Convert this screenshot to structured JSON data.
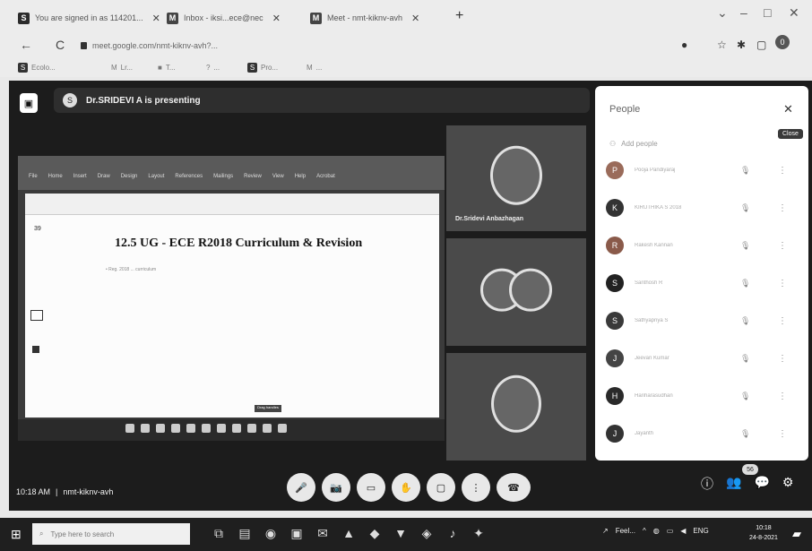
{
  "browser": {
    "tabs": [
      {
        "icon": "S",
        "label": "You are signed in as 114201..."
      },
      {
        "icon": "M",
        "label": "Inbox - iksi...ece@nec"
      },
      {
        "icon": "M",
        "label": "Meet - nmt-kiknv-avh"
      }
    ],
    "new_tab": "+",
    "window_controls": [
      "⌄",
      "–",
      "□",
      "✕"
    ],
    "back": "←",
    "reload": "C",
    "url": "meet.google.com/nmt-kiknv-avh?...",
    "profile_initial": "0"
  },
  "bookmarks": [
    {
      "icon": "S",
      "label": "Ecolo..."
    },
    {
      "icon": "M",
      "label": "Lr..."
    },
    {
      "icon": "■",
      "label": "T..."
    },
    {
      "icon": "?",
      "label": "..."
    },
    {
      "icon": "S",
      "label": "Pro..."
    },
    {
      "icon": "M",
      "label": "..."
    }
  ],
  "meet": {
    "presenting_text": "Dr.SRIDEVI A is presenting",
    "presenter_initial": "S",
    "shared_doc": {
      "ribbon_menu": [
        "File",
        "Home",
        "Insert",
        "Draw",
        "Design",
        "Layout",
        "References",
        "Mailings",
        "Review",
        "View",
        "Help",
        "Acrobat"
      ],
      "page_num": "39",
      "title": "12.5 UG - ECE R2018 Curriculum & Revision",
      "subtitle": "• Reg. 2018 ... curriculum",
      "footer_tag": "Drag handles"
    },
    "tiles": [
      {
        "name": "Dr.Sridevi Anbazhagan"
      },
      {
        "name": ""
      },
      {
        "name": ""
      }
    ],
    "meeting_time": "10:18 AM",
    "meeting_code": "nmt-kiknv-avh",
    "participant_count": "56"
  },
  "people_panel": {
    "title": "People",
    "close_tooltip": "Close",
    "add_people": "Add people",
    "participants": [
      {
        "initial": "P",
        "name": "Pooja Pandiyaraj"
      },
      {
        "initial": "K",
        "name": "KIRUTHIKA S 2018"
      },
      {
        "initial": "R",
        "name": "Rakesh Kannan"
      },
      {
        "initial": "S",
        "name": "Santhosh R"
      },
      {
        "initial": "S",
        "name": "Sathyapriya S"
      },
      {
        "initial": "J",
        "name": "Jeevan Kumar"
      },
      {
        "initial": "H",
        "name": "Hariharasudhan"
      },
      {
        "initial": "J",
        "name": "Jayanth"
      }
    ]
  },
  "controls": [
    "🎤",
    "📷",
    "▭",
    "✋",
    "▢",
    "⋮",
    "☎"
  ],
  "right_controls": [
    "ⓘ",
    "👥",
    "💬",
    "⚙"
  ],
  "taskbar": {
    "search_placeholder": "Type here to search",
    "tray_text": "Feel...",
    "lang": "ENG",
    "time": "10:18",
    "date": "24-8-2021"
  }
}
